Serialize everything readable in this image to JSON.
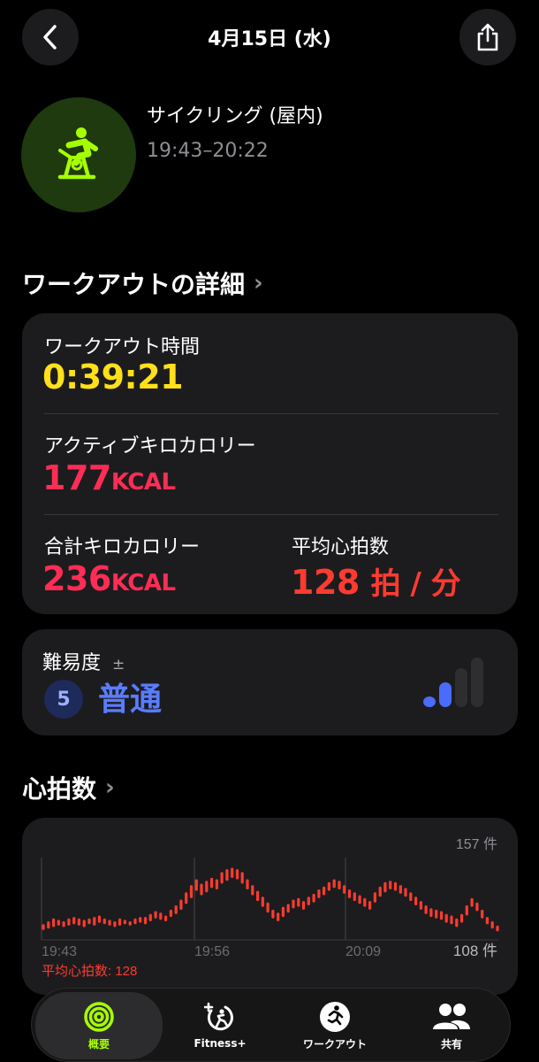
{
  "header": {
    "title": "4月15日 (水)"
  },
  "activity": {
    "name": "サイクリング (屋内)",
    "time_range": "19:43–20:22",
    "icon": "indoor-cycle-icon",
    "accent": "#a6ff00"
  },
  "details": {
    "section_title": "ワークアウトの詳細",
    "workout_time_label": "ワークアウト時間",
    "workout_time_value": "0:39:21",
    "active_kcal_label": "アクティブキロカロリー",
    "active_kcal_value": "177",
    "active_kcal_unit": "KCAL",
    "total_kcal_label": "合計キロカロリー",
    "total_kcal_value": "236",
    "total_kcal_unit": "KCAL",
    "avg_hr_label": "平均心拍数",
    "avg_hr_value": "128",
    "avg_hr_unit": "拍 / 分",
    "colors": {
      "time": "#ffe01a",
      "kcal": "#ff2d55",
      "hr": "#ff3b30"
    }
  },
  "effort": {
    "label": "難易度",
    "plusminus": "±",
    "level": "5",
    "value": "普通",
    "bars_filled": 2,
    "bars_total": 4
  },
  "heart_rate": {
    "section_title": "心拍数"
  },
  "chart_data": {
    "type": "range",
    "count_label": "157 件",
    "min_label": "108 件",
    "avg_label": "平均心拍数: 128",
    "x_ticks": [
      "19:43",
      "19:56",
      "20:09"
    ],
    "ylim": [
      105,
      160
    ],
    "series": [
      {
        "color": "#ff3b30",
        "ranges": [
          [
            110,
            114
          ],
          [
            111,
            116
          ],
          [
            112,
            118
          ],
          [
            113,
            117
          ],
          [
            112,
            116
          ],
          [
            113,
            118
          ],
          [
            114,
            119
          ],
          [
            113,
            118
          ],
          [
            112,
            117
          ],
          [
            114,
            118
          ],
          [
            113,
            119
          ],
          [
            115,
            120
          ],
          [
            114,
            118
          ],
          [
            113,
            117
          ],
          [
            112,
            116
          ],
          [
            113,
            118
          ],
          [
            114,
            117
          ],
          [
            113,
            116
          ],
          [
            114,
            118
          ],
          [
            115,
            119
          ],
          [
            114,
            119
          ],
          [
            116,
            121
          ],
          [
            118,
            123
          ],
          [
            117,
            122
          ],
          [
            116,
            120
          ],
          [
            119,
            124
          ],
          [
            121,
            127
          ],
          [
            124,
            131
          ],
          [
            128,
            136
          ],
          [
            132,
            141
          ],
          [
            137,
            145
          ],
          [
            134,
            142
          ],
          [
            136,
            144
          ],
          [
            139,
            146
          ],
          [
            138,
            145
          ],
          [
            142,
            150
          ],
          [
            144,
            152
          ],
          [
            146,
            153
          ],
          [
            145,
            152
          ],
          [
            142,
            150
          ],
          [
            138,
            145
          ],
          [
            134,
            141
          ],
          [
            130,
            137
          ],
          [
            126,
            133
          ],
          [
            122,
            129
          ],
          [
            118,
            124
          ],
          [
            116,
            122
          ],
          [
            119,
            126
          ],
          [
            122,
            128
          ],
          [
            125,
            131
          ],
          [
            126,
            132
          ],
          [
            124,
            130
          ],
          [
            127,
            133
          ],
          [
            129,
            135
          ],
          [
            132,
            138
          ],
          [
            134,
            140
          ],
          [
            137,
            143
          ],
          [
            139,
            145
          ],
          [
            138,
            144
          ],
          [
            135,
            141
          ],
          [
            132,
            138
          ],
          [
            130,
            136
          ],
          [
            128,
            134
          ],
          [
            126,
            132
          ],
          [
            124,
            130
          ],
          [
            129,
            136
          ],
          [
            133,
            140
          ],
          [
            136,
            143
          ],
          [
            138,
            144
          ],
          [
            137,
            143
          ],
          [
            135,
            141
          ],
          [
            133,
            139
          ],
          [
            130,
            136
          ],
          [
            127,
            133
          ],
          [
            124,
            130
          ],
          [
            121,
            127
          ],
          [
            119,
            125
          ],
          [
            118,
            124
          ],
          [
            117,
            123
          ],
          [
            115,
            121
          ],
          [
            114,
            120
          ],
          [
            112,
            118
          ],
          [
            115,
            121
          ],
          [
            120,
            127
          ],
          [
            126,
            132
          ],
          [
            123,
            129
          ],
          [
            118,
            124
          ],
          [
            114,
            119
          ],
          [
            111,
            116
          ],
          [
            109,
            113
          ]
        ]
      }
    ]
  },
  "tabs": [
    {
      "label": "概要",
      "icon": "activity-rings-icon",
      "active": true
    },
    {
      "label": "Fitness+",
      "icon": "fitness-plus-icon",
      "active": false
    },
    {
      "label": "ワークアウト",
      "icon": "running-figure-icon",
      "active": false
    },
    {
      "label": "共有",
      "icon": "people-icon",
      "active": false
    }
  ]
}
